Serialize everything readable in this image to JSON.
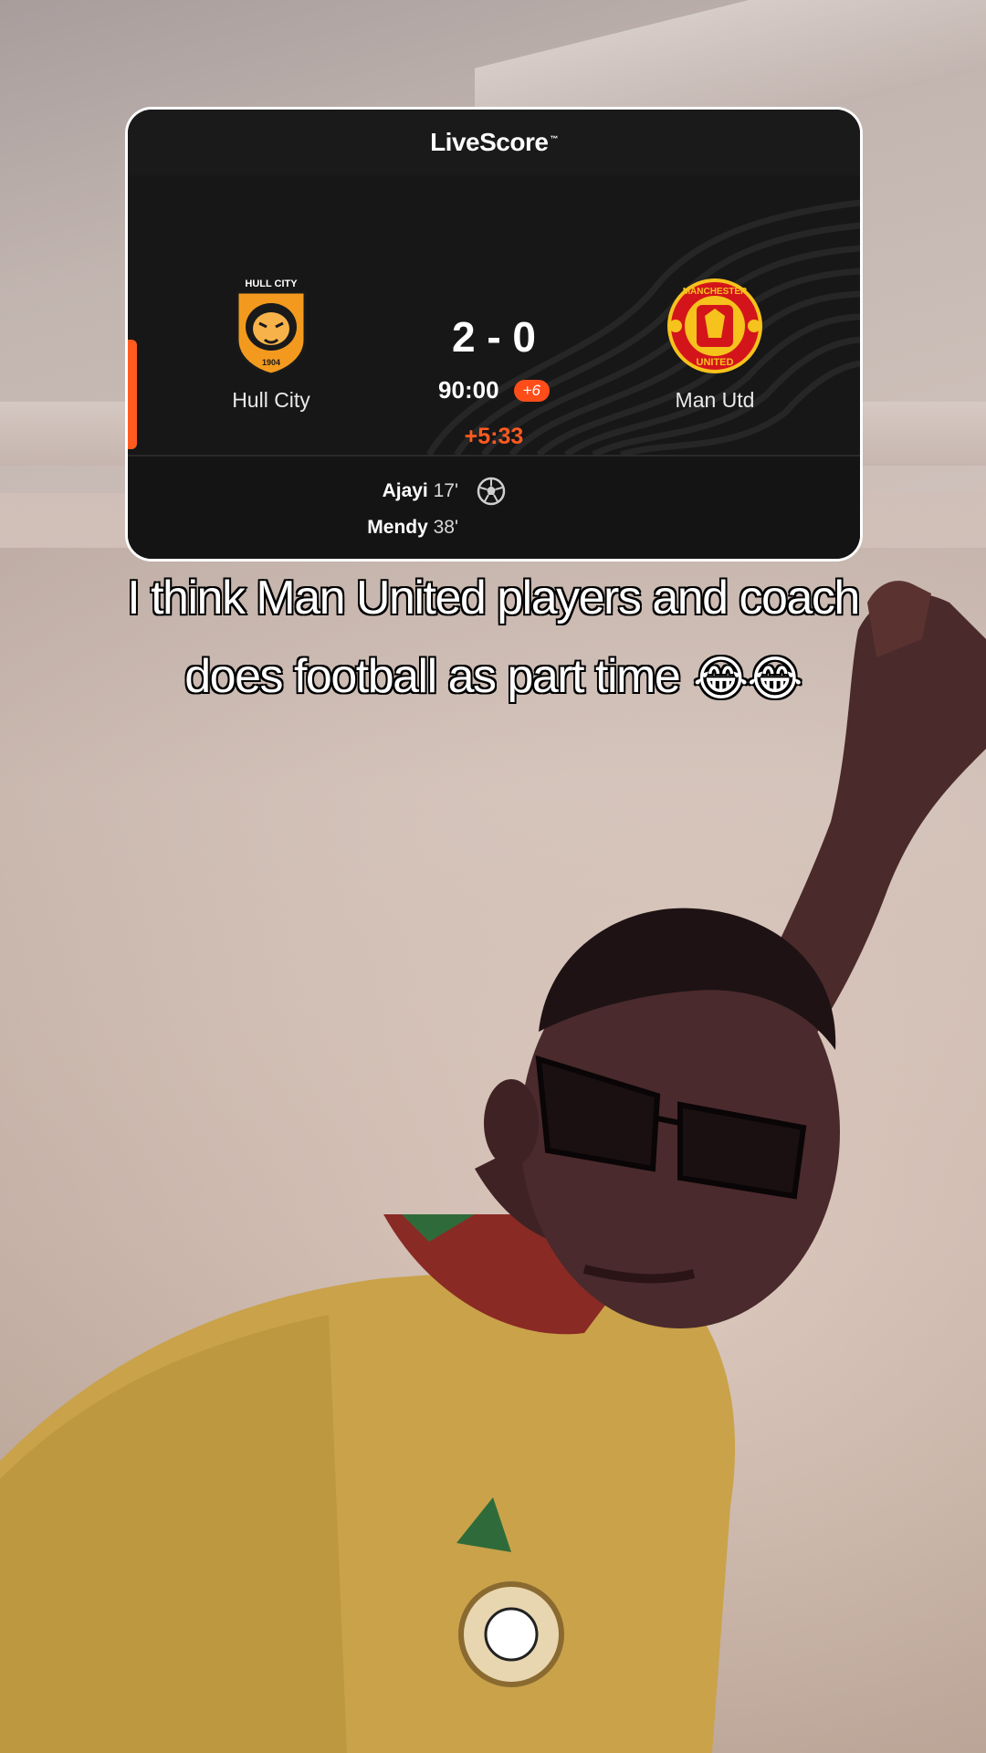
{
  "scoreboard": {
    "brand": "LiveScore",
    "brand_tm": "™",
    "home_team": {
      "name": "Hull City",
      "badge_text": "HULL CITY",
      "badge_year": "1904"
    },
    "away_team": {
      "name": "Man Utd",
      "badge_text_top": "MANCHESTER",
      "badge_text_bottom": "UNITED"
    },
    "score": "2 - 0",
    "clock": "90:00",
    "added_time": "+6",
    "stoppage_elapsed": "+5:33",
    "goals": [
      {
        "player": "Ajayi",
        "minute": "17'"
      },
      {
        "player": "Mendy",
        "minute": "38'"
      }
    ],
    "accent_color": "#ff5a1f"
  },
  "caption": {
    "line1": "I think Man United players and coach",
    "line2": "does football as part time",
    "emoji": "😂😂"
  },
  "icons": [
    "hull-city-badge-icon",
    "man-utd-badge-icon",
    "football-icon",
    "laughing-emoji-icon"
  ]
}
